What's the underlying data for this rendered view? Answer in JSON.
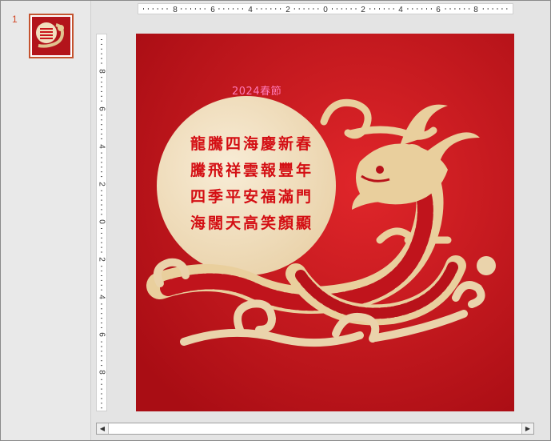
{
  "thumbnails": [
    {
      "number": "1"
    }
  ],
  "rulers": {
    "horizontal_labels": [
      "8",
      "6",
      "4",
      "2",
      "0",
      "2",
      "4",
      "6",
      "8"
    ],
    "vertical_labels": [
      "8",
      "6",
      "4",
      "2",
      "0",
      "2",
      "4",
      "6",
      "8"
    ]
  },
  "slide": {
    "caption": "2024春節",
    "poem": [
      "龍騰四海慶新春",
      "騰飛祥雲報豐年",
      "四季平安福滿門",
      "海闊天高笑顏顯"
    ]
  },
  "scrollbar": {
    "left_arrow": "◀",
    "right_arrow": "▶"
  },
  "colors": {
    "slide_red": "#c8141c",
    "moon_cream": "#f3e3c5",
    "dragon_gold": "#e9cf9d",
    "poem_red": "#d40f14",
    "caption_pink": "#ff7ab8",
    "slide_number": "#d24726"
  },
  "icons": {
    "thumbnail": "dragon-slide-thumbnail",
    "scroll_left": "arrow-left-icon",
    "scroll_right": "arrow-right-icon"
  }
}
